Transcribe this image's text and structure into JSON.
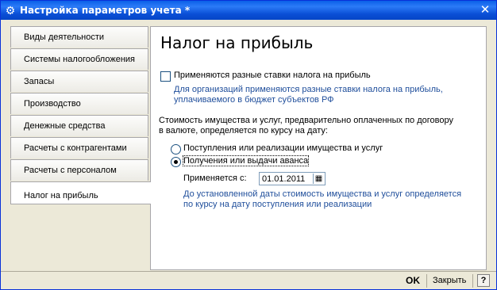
{
  "window": {
    "title": "Настройка параметров учета *"
  },
  "tabs": [
    {
      "label": "Виды деятельности"
    },
    {
      "label": "Системы налогообложения"
    },
    {
      "label": "Запасы"
    },
    {
      "label": "Производство"
    },
    {
      "label": "Денежные средства"
    },
    {
      "label": "Расчеты с контрагентами"
    },
    {
      "label": "Расчеты с персоналом"
    },
    {
      "label": "Налог на прибыль",
      "active": true
    }
  ],
  "panel": {
    "title": "Налог на прибыль",
    "different_rates": {
      "label": "Применяются разные ставки налога на прибыль",
      "checked": false,
      "hint_line1": "Для организаций применяются разные ставки налога на прибыль,",
      "hint_line2": "уплачиваемого в бюджет субъектов РФ"
    },
    "cost_text_line1": "Стоимость имущества и услуг, предварительно оплаченных по договору",
    "cost_text_line2": "в валюте, определяется по курсу на дату:",
    "options": [
      {
        "label": "Поступления или реализации имущества и услуг",
        "checked": false
      },
      {
        "label": "Получения или выдачи аванса",
        "checked": true
      }
    ],
    "applies_from_label": "Применяется с:",
    "applies_from_date": "01.01.2011",
    "note_line1": "До установленной даты стоимость имущества и услуг определяется",
    "note_line2": "по курсу на дату поступления или реализации"
  },
  "footer": {
    "ok_label": "OK",
    "close_label": "Закрыть",
    "help_label": "?"
  },
  "colors": {
    "titlebar": "#0a5fe8",
    "hint_text": "#1f4e9b",
    "window_bg": "#ece9d8"
  }
}
